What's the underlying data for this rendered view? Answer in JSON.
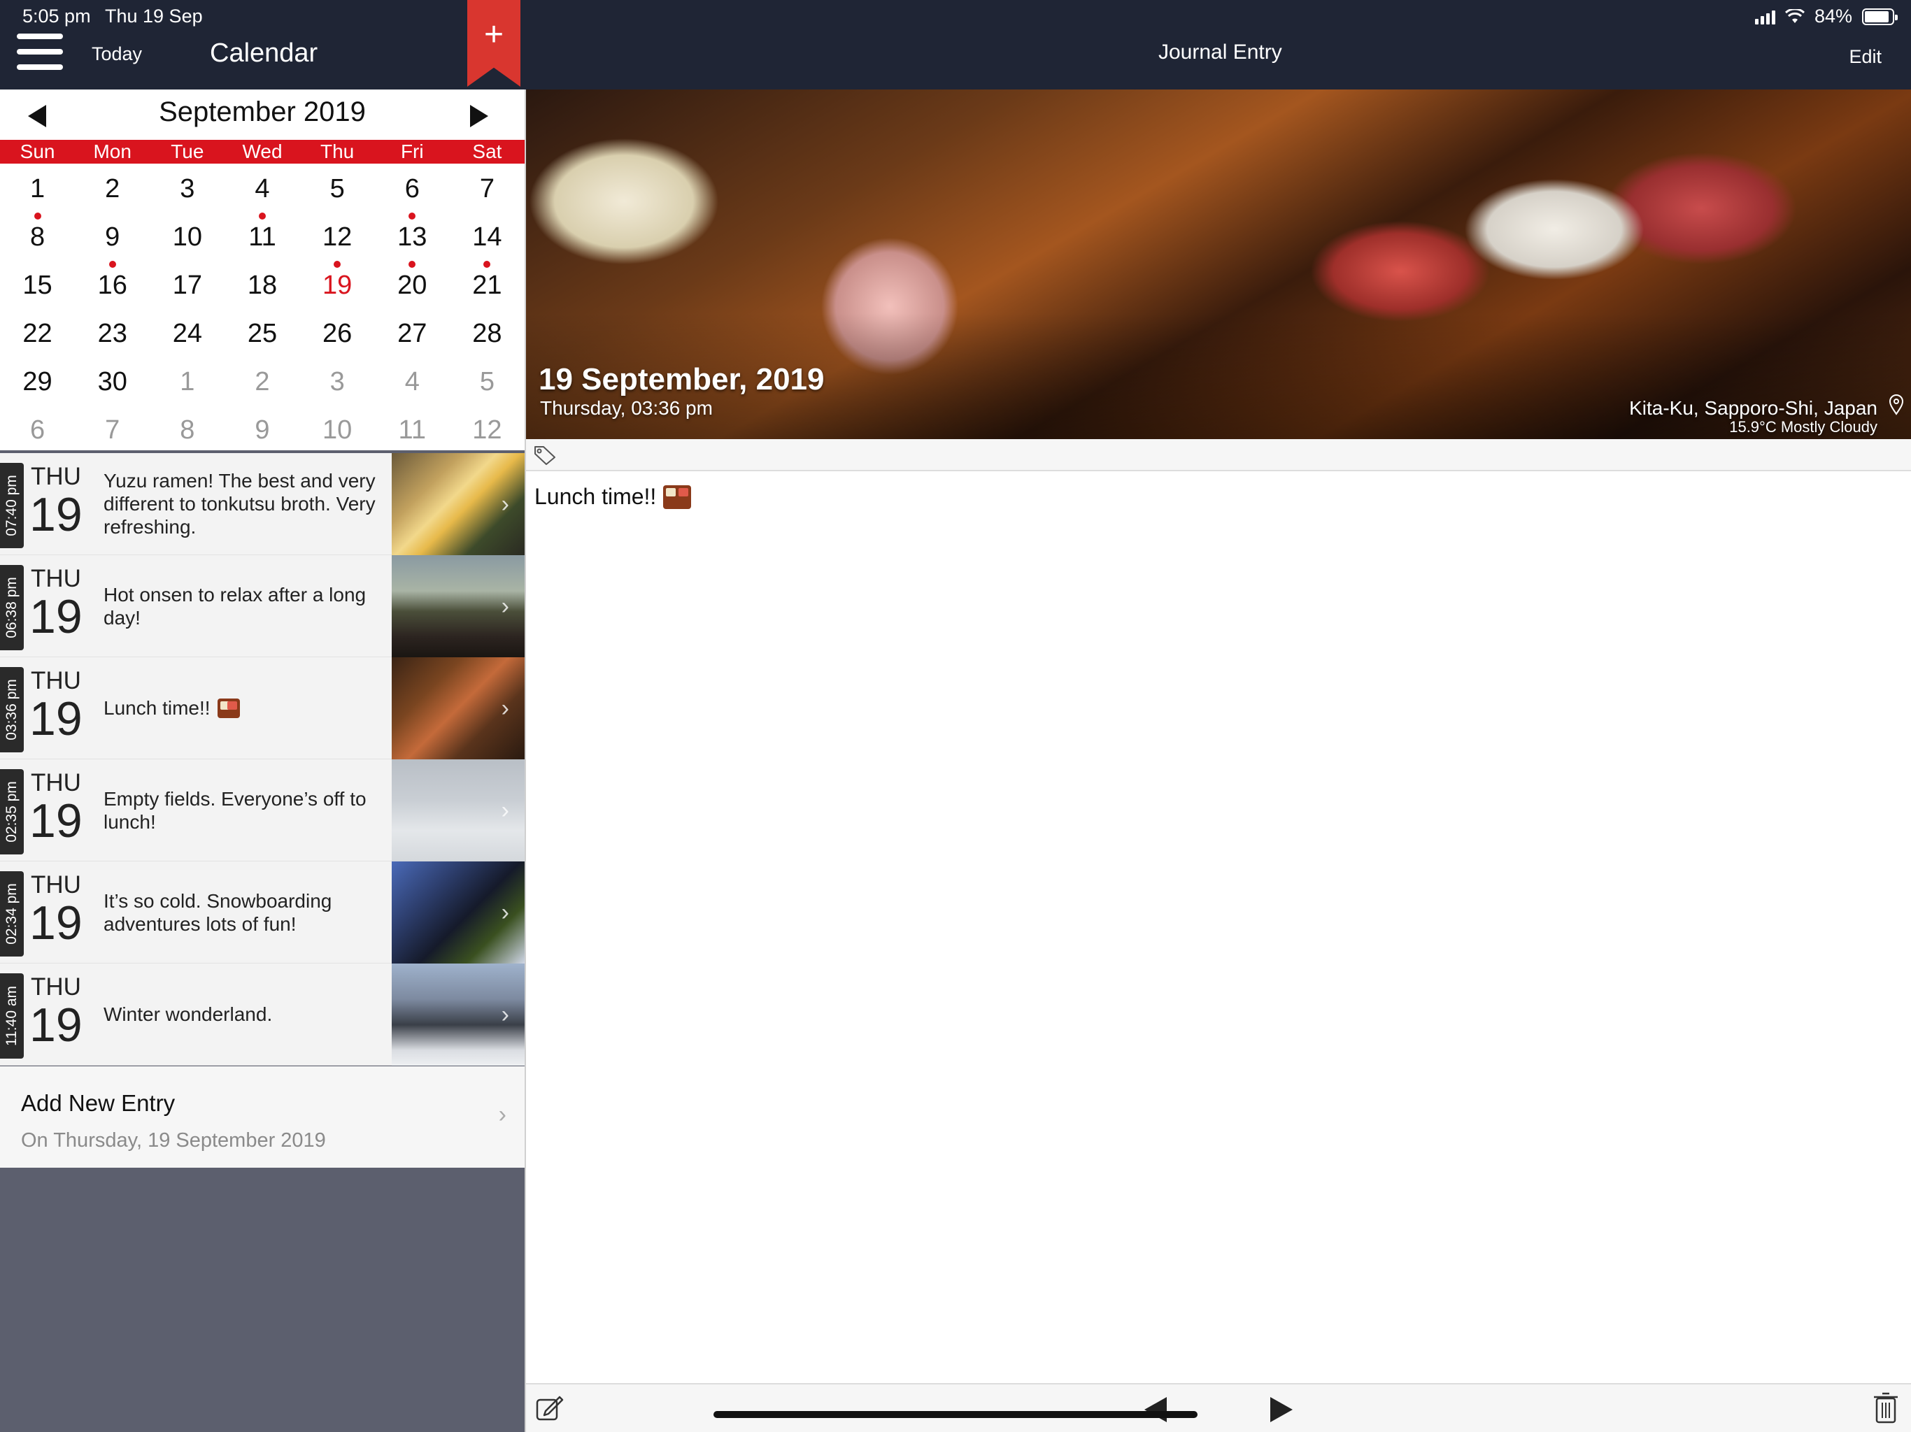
{
  "status_bar": {
    "time": "5:05 pm",
    "date": "Thu 19 Sep",
    "battery": "84%"
  },
  "nav": {
    "today": "Today",
    "title": "Calendar",
    "add": "+"
  },
  "detail_nav": {
    "title": "Journal Entry",
    "edit": "Edit"
  },
  "calendar": {
    "month": "September 2019",
    "weekdays": [
      "Sun",
      "Mon",
      "Tue",
      "Wed",
      "Thu",
      "Fri",
      "Sat"
    ],
    "days": [
      {
        "n": "1",
        "m": false,
        "dot": false,
        "today": false
      },
      {
        "n": "2",
        "m": false,
        "dot": false,
        "today": false
      },
      {
        "n": "3",
        "m": false,
        "dot": false,
        "today": false
      },
      {
        "n": "4",
        "m": false,
        "dot": false,
        "today": false
      },
      {
        "n": "5",
        "m": false,
        "dot": false,
        "today": false
      },
      {
        "n": "6",
        "m": false,
        "dot": false,
        "today": false
      },
      {
        "n": "7",
        "m": false,
        "dot": false,
        "today": false
      },
      {
        "n": "8",
        "m": false,
        "dot": true,
        "today": false
      },
      {
        "n": "9",
        "m": false,
        "dot": false,
        "today": false
      },
      {
        "n": "10",
        "m": false,
        "dot": false,
        "today": false
      },
      {
        "n": "11",
        "m": false,
        "dot": true,
        "today": false
      },
      {
        "n": "12",
        "m": false,
        "dot": false,
        "today": false
      },
      {
        "n": "13",
        "m": false,
        "dot": true,
        "today": false
      },
      {
        "n": "14",
        "m": false,
        "dot": false,
        "today": false
      },
      {
        "n": "15",
        "m": false,
        "dot": false,
        "today": false
      },
      {
        "n": "16",
        "m": false,
        "dot": true,
        "today": false
      },
      {
        "n": "17",
        "m": false,
        "dot": false,
        "today": false
      },
      {
        "n": "18",
        "m": false,
        "dot": false,
        "today": false
      },
      {
        "n": "19",
        "m": false,
        "dot": true,
        "today": true
      },
      {
        "n": "20",
        "m": false,
        "dot": true,
        "today": false
      },
      {
        "n": "21",
        "m": false,
        "dot": true,
        "today": false
      },
      {
        "n": "22",
        "m": false,
        "dot": false,
        "today": false
      },
      {
        "n": "23",
        "m": false,
        "dot": false,
        "today": false
      },
      {
        "n": "24",
        "m": false,
        "dot": false,
        "today": false
      },
      {
        "n": "25",
        "m": false,
        "dot": false,
        "today": false
      },
      {
        "n": "26",
        "m": false,
        "dot": false,
        "today": false
      },
      {
        "n": "27",
        "m": false,
        "dot": false,
        "today": false
      },
      {
        "n": "28",
        "m": false,
        "dot": false,
        "today": false
      },
      {
        "n": "29",
        "m": false,
        "dot": false,
        "today": false
      },
      {
        "n": "30",
        "m": false,
        "dot": false,
        "today": false
      },
      {
        "n": "1",
        "m": true,
        "dot": false,
        "today": false
      },
      {
        "n": "2",
        "m": true,
        "dot": false,
        "today": false
      },
      {
        "n": "3",
        "m": true,
        "dot": false,
        "today": false
      },
      {
        "n": "4",
        "m": true,
        "dot": false,
        "today": false
      },
      {
        "n": "5",
        "m": true,
        "dot": false,
        "today": false
      },
      {
        "n": "6",
        "m": true,
        "dot": false,
        "today": false
      },
      {
        "n": "7",
        "m": true,
        "dot": false,
        "today": false
      },
      {
        "n": "8",
        "m": true,
        "dot": false,
        "today": false
      },
      {
        "n": "9",
        "m": true,
        "dot": false,
        "today": false
      },
      {
        "n": "10",
        "m": true,
        "dot": false,
        "today": false
      },
      {
        "n": "11",
        "m": true,
        "dot": false,
        "today": false
      },
      {
        "n": "12",
        "m": true,
        "dot": false,
        "today": false
      }
    ]
  },
  "entries": [
    {
      "time": "07:40 pm",
      "weekday": "THU",
      "day": "19",
      "text": "Yuzu ramen! The best and very different to tonkutsu broth. Very refreshing.",
      "thumb": "ramen-photo"
    },
    {
      "time": "06:38 pm",
      "weekday": "THU",
      "day": "19",
      "text": "Hot onsen to relax after a long day!",
      "thumb": "onsen-photo"
    },
    {
      "time": "03:36 pm",
      "weekday": "THU",
      "day": "19",
      "text": "Lunch time!!",
      "thumb": "bento-photo"
    },
    {
      "time": "02:35 pm",
      "weekday": "THU",
      "day": "19",
      "text": "Empty fields. Everyone’s off to lunch!",
      "thumb": "ski-field-photo"
    },
    {
      "time": "02:34 pm",
      "weekday": "THU",
      "day": "19",
      "text": "It’s so cold. Snowboarding adventures lots of fun!",
      "thumb": "snowboarders-photo"
    },
    {
      "time": "11:40 am",
      "weekday": "THU",
      "day": "19",
      "text": "Winter wonderland.",
      "thumb": "snowy-trees-photo"
    }
  ],
  "add_entry": {
    "title": "Add New Entry",
    "subtitle": "On Thursday, 19 September 2019"
  },
  "detail": {
    "date": "19 September, 2019",
    "time": "Thursday, 03:36 pm",
    "location": "Kita-Ku, Sapporo-Shi, Japan",
    "weather": "15.9°C Mostly Cloudy",
    "body": "Lunch time!!"
  },
  "colors": {
    "accent": "#d9141e",
    "nav_bg": "#1f2535",
    "ribbon": "#d9362f",
    "sidebar_bg": "#5c5f6e"
  }
}
